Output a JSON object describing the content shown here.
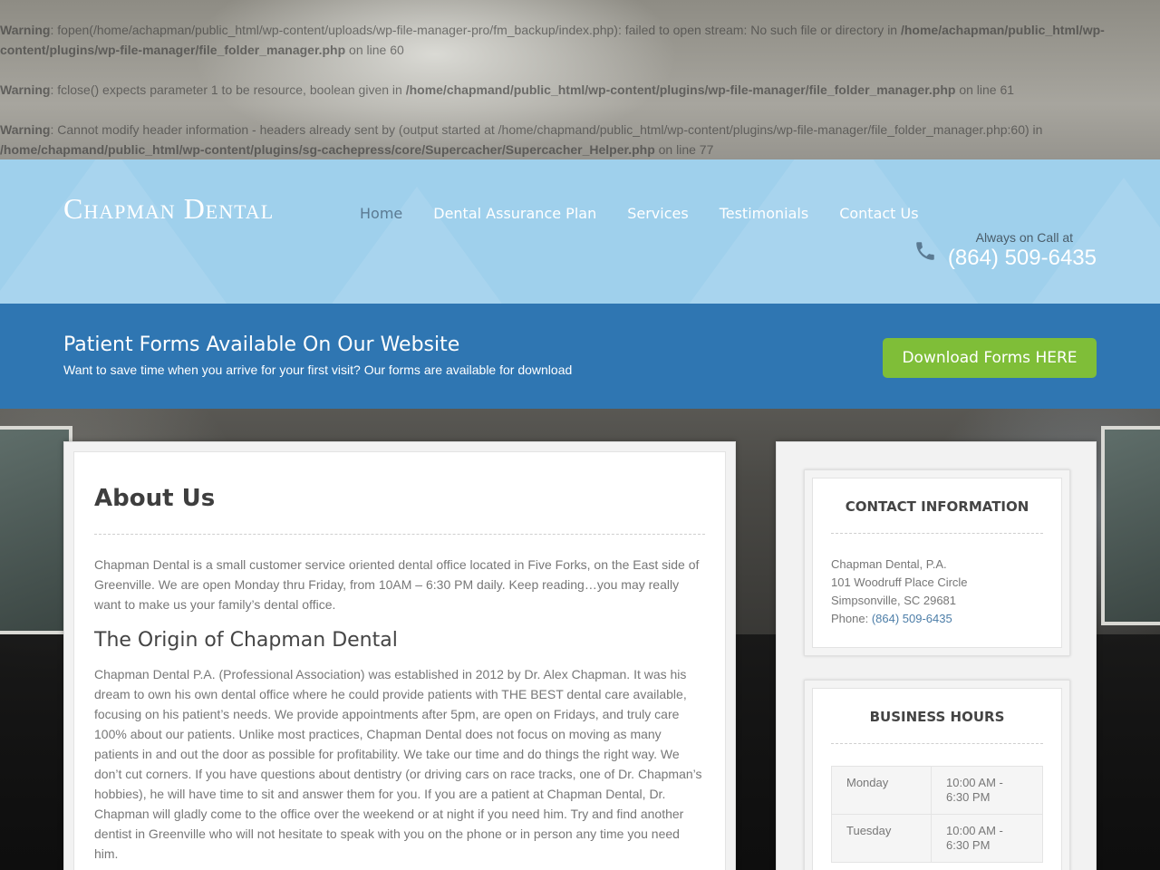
{
  "warnings": [
    {
      "label": "Warning",
      "text": ": fopen(/home/achapman/public_html/wp-content/uploads/wp-file-manager-pro/fm_backup/index.php): failed to open stream: No such file or directory in ",
      "path": "/home/achapman/public_html/wp-content/plugins/wp-file-manager/file_folder_manager.php",
      "tail": " on line 60"
    },
    {
      "label": "Warning",
      "text": ": fclose() expects parameter 1 to be resource, boolean given in ",
      "path": "/home/chapmand/public_html/wp-content/plugins/wp-file-manager/file_folder_manager.php",
      "tail": " on line 61"
    },
    {
      "label": "Warning",
      "text": ": Cannot modify header information - headers already sent by (output started at /home/chapmand/public_html/wp-content/plugins/wp-file-manager/file_folder_manager.php:60) in ",
      "path": "/home/chapmand/public_html/wp-content/plugins/sg-cachepress/core/Supercacher/Supercacher_Helper.php",
      "tail": " on line 77"
    }
  ],
  "header": {
    "logo": "Chapman Dental",
    "nav": [
      {
        "label": "Home"
      },
      {
        "label": "Dental Assurance Plan"
      },
      {
        "label": "Services"
      },
      {
        "label": "Testimonials"
      },
      {
        "label": "Contact Us"
      }
    ],
    "call_label": "Always on Call at",
    "phone": "(864) 509-6435"
  },
  "forms_bar": {
    "title": "Patient Forms Available On Our Website",
    "subtitle": "Want to save time when you arrive for your first visit? Our forms are available for download",
    "button": "Download Forms HERE"
  },
  "main": {
    "title": "About Us",
    "intro": "Chapman Dental is a small customer service oriented dental office located in Five Forks, on the East side of Greenville.  We are open Monday thru Friday, from 10AM – 6:30 PM daily.  Keep reading…you may really want to make us your family’s dental office.",
    "origin_heading": "The Origin of Chapman Dental",
    "origin_text": "Chapman Dental P.A. (Professional Association) was established in 2012 by Dr. Alex Chapman. It was his dream to own his own dental office where he could provide patients with THE BEST dental care available, focusing on his patient’s needs. We provide appointments after 5pm, are open on Fridays, and truly care 100% about our patients. Unlike most practices, Chapman Dental does not focus on moving as many patients in and out the door as possible for profitability. We take our time and do things the right way. We don’t cut corners. If you have questions about dentistry (or driving cars on race tracks, one of Dr. Chapman’s hobbies), he will have time to sit and answer them for you. If you are a patient at Chapman Dental, Dr. Chapman will gladly come to the office over the weekend or at night if you need him. Try and find another dentist in Greenville who will not hesitate to speak with you on the phone or in person any time you need him."
  },
  "sidebar": {
    "contact": {
      "title": "CONTACT INFORMATION",
      "name": "Chapman Dental, P.A.",
      "street": "101 Woodruff Place Circle",
      "city": "Simpsonville, SC 29681",
      "phone_label": "Phone: ",
      "phone": "(864) 509-6435"
    },
    "hours": {
      "title": "BUSINESS HOURS",
      "rows": [
        {
          "day": "Monday",
          "time": "10:00 AM - 6:30 PM"
        },
        {
          "day": "Tuesday",
          "time": "10:00 AM - 6:30 PM"
        }
      ]
    }
  },
  "colors": {
    "header_bg": "#9fd0ec",
    "forms_bar_bg": "#2f76b2",
    "download_button": "#7fbe38",
    "nav_active": "#5b7a92",
    "link": "#4d7ea8"
  },
  "icons": {
    "phone": "phone-icon"
  }
}
